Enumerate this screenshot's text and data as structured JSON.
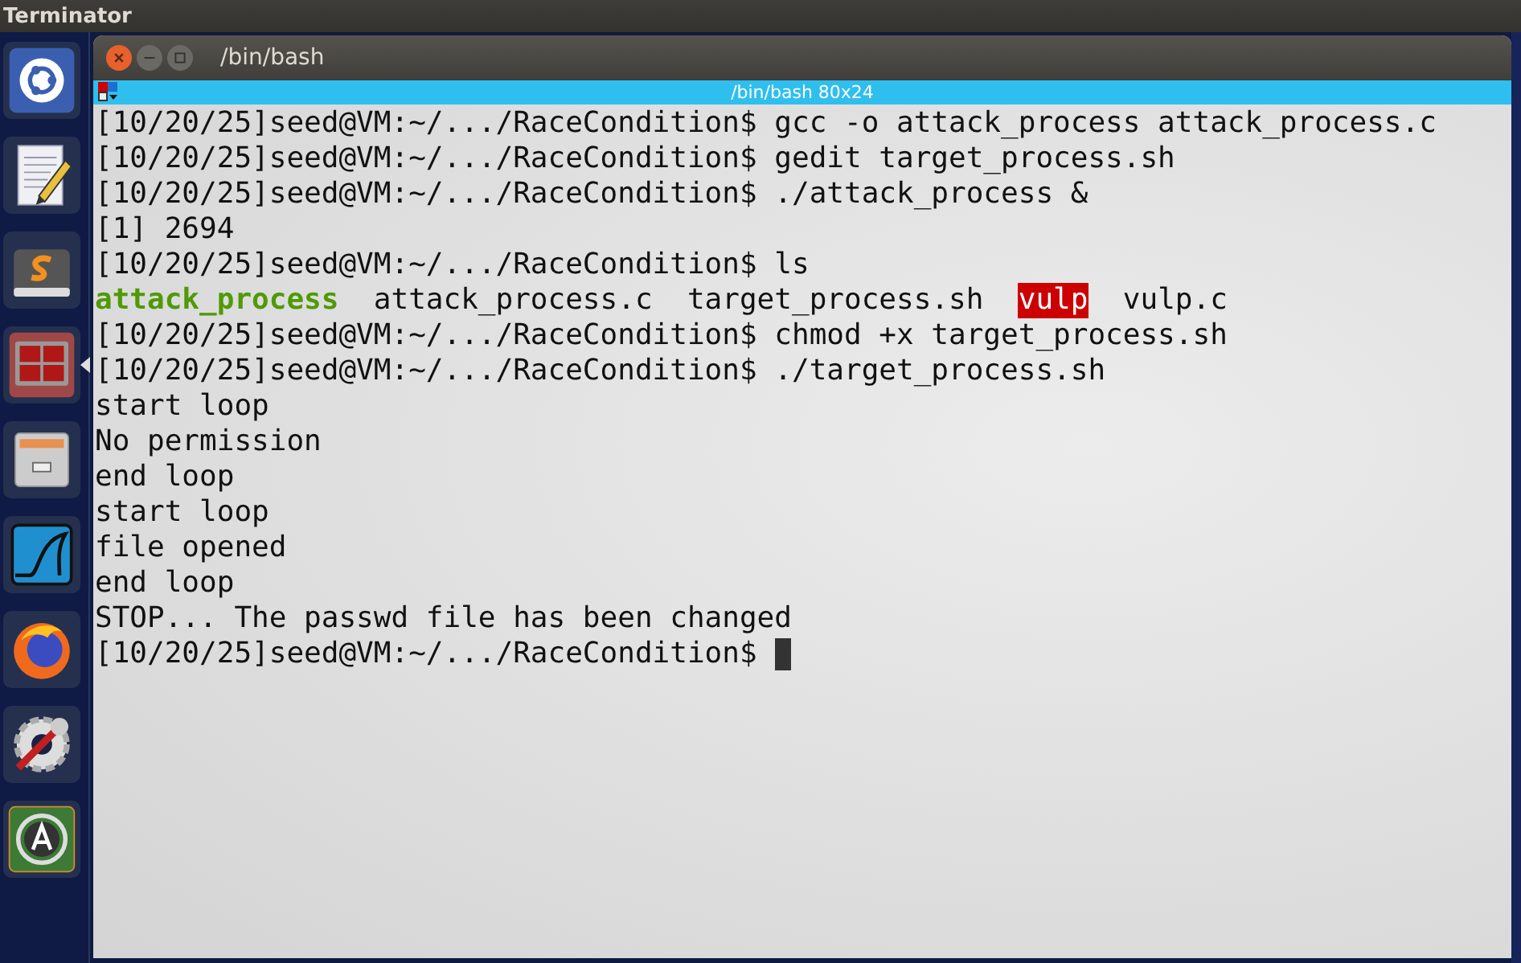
{
  "top_bar": {
    "title": "Terminator"
  },
  "launcher": [
    {
      "kind": "ubuntu",
      "selected": false
    },
    {
      "kind": "editor",
      "selected": false
    },
    {
      "kind": "sublime",
      "selected": false
    },
    {
      "kind": "terminal",
      "selected": true
    },
    {
      "kind": "files",
      "selected": false
    },
    {
      "kind": "wireshark",
      "selected": false
    },
    {
      "kind": "firefox",
      "selected": false
    },
    {
      "kind": "settings",
      "selected": false
    },
    {
      "kind": "updater",
      "selected": false
    }
  ],
  "window": {
    "title": "/bin/bash",
    "tab_title": "/bin/bash 80x24"
  },
  "terminal": {
    "cursor": true,
    "lines": [
      [
        {
          "kind": "plain",
          "text": "[10/20/25]seed@VM:~/.../RaceCondition$ gcc -o attack_process attack_process.c"
        }
      ],
      [
        {
          "kind": "plain",
          "text": "[10/20/25]seed@VM:~/.../RaceCondition$ gedit target_process.sh"
        }
      ],
      [
        {
          "kind": "plain",
          "text": "[10/20/25]seed@VM:~/.../RaceCondition$ ./attack_process &"
        }
      ],
      [
        {
          "kind": "plain",
          "text": "[1] 2694"
        }
      ],
      [
        {
          "kind": "plain",
          "text": "[10/20/25]seed@VM:~/.../RaceCondition$ ls"
        }
      ],
      [
        {
          "kind": "executable",
          "text": "attack_process"
        },
        {
          "kind": "plain",
          "text": "  attack_process.c  target_process.sh  "
        },
        {
          "kind": "highlighted",
          "text": "vulp"
        },
        {
          "kind": "plain",
          "text": "  vulp.c"
        }
      ],
      [
        {
          "kind": "plain",
          "text": "[10/20/25]seed@VM:~/.../RaceCondition$ chmod +x target_process.sh"
        }
      ],
      [
        {
          "kind": "plain",
          "text": "[10/20/25]seed@VM:~/.../RaceCondition$ ./target_process.sh"
        }
      ],
      [
        {
          "kind": "plain",
          "text": "start loop"
        }
      ],
      [
        {
          "kind": "plain",
          "text": "No permission"
        }
      ],
      [
        {
          "kind": "plain",
          "text": "end loop"
        }
      ],
      [
        {
          "kind": "plain",
          "text": "start loop"
        }
      ],
      [
        {
          "kind": "plain",
          "text": "file opened"
        }
      ],
      [
        {
          "kind": "plain",
          "text": "end loop"
        }
      ],
      [
        {
          "kind": "plain",
          "text": "STOP... The passwd file has been changed"
        }
      ],
      [
        {
          "kind": "plain",
          "text": "[10/20/25]seed@VM:~/.../RaceCondition$ "
        }
      ]
    ]
  }
}
